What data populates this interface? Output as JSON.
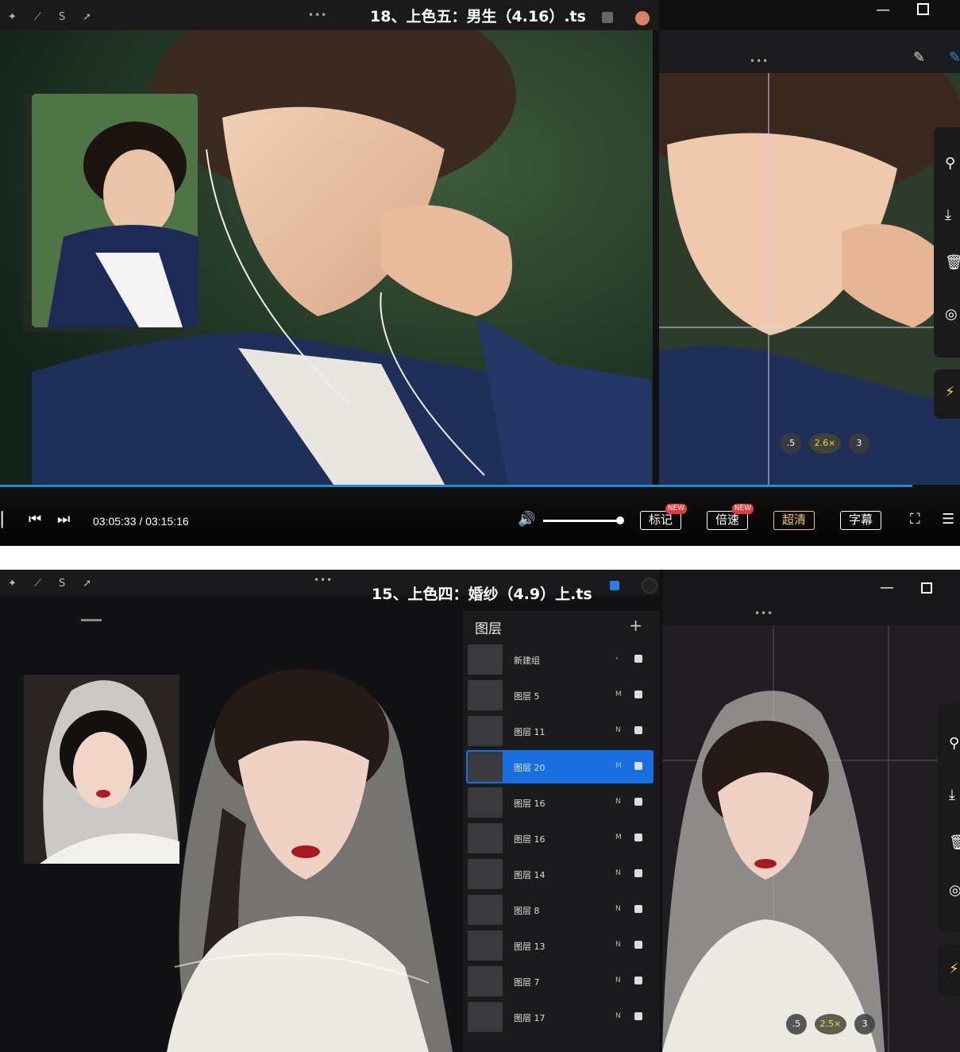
{
  "frame1": {
    "title": "18、上色五：男生（4.16）.ts",
    "time_label": "03:05:33 / 03:15:16",
    "progress": 0.95,
    "volume": 1.0,
    "buttons": {
      "mark": "标记",
      "speed": "倍速",
      "hd": "超清",
      "subtitle": "字幕"
    },
    "new_badge": "NEW",
    "speed_options": [
      ".5",
      "2.6×",
      "3"
    ]
  },
  "frame2": {
    "title": "15、上色四：婚纱（4.9）上.ts",
    "layers_title": "图层",
    "layers": [
      {
        "name": "新建组",
        "blend": "›"
      },
      {
        "name": "图层 5",
        "blend": "M"
      },
      {
        "name": "图层 11",
        "blend": "N"
      },
      {
        "name": "图层 20",
        "blend": "M",
        "active": true
      },
      {
        "name": "图层 16",
        "blend": "N"
      },
      {
        "name": "图层 16",
        "blend": "M"
      },
      {
        "name": "图层 14",
        "blend": "N"
      },
      {
        "name": "图层 8",
        "blend": "N"
      },
      {
        "name": "图层 13",
        "blend": "N"
      },
      {
        "name": "图层 7",
        "blend": "N"
      },
      {
        "name": "图层 17",
        "blend": "N"
      }
    ],
    "speed_options": [
      ".5",
      "2.5×",
      "3"
    ]
  },
  "colors": {
    "progress": "#1f8ad6",
    "accent_blue": "#1a6fe0",
    "hd_gold": "#f3c66d"
  }
}
